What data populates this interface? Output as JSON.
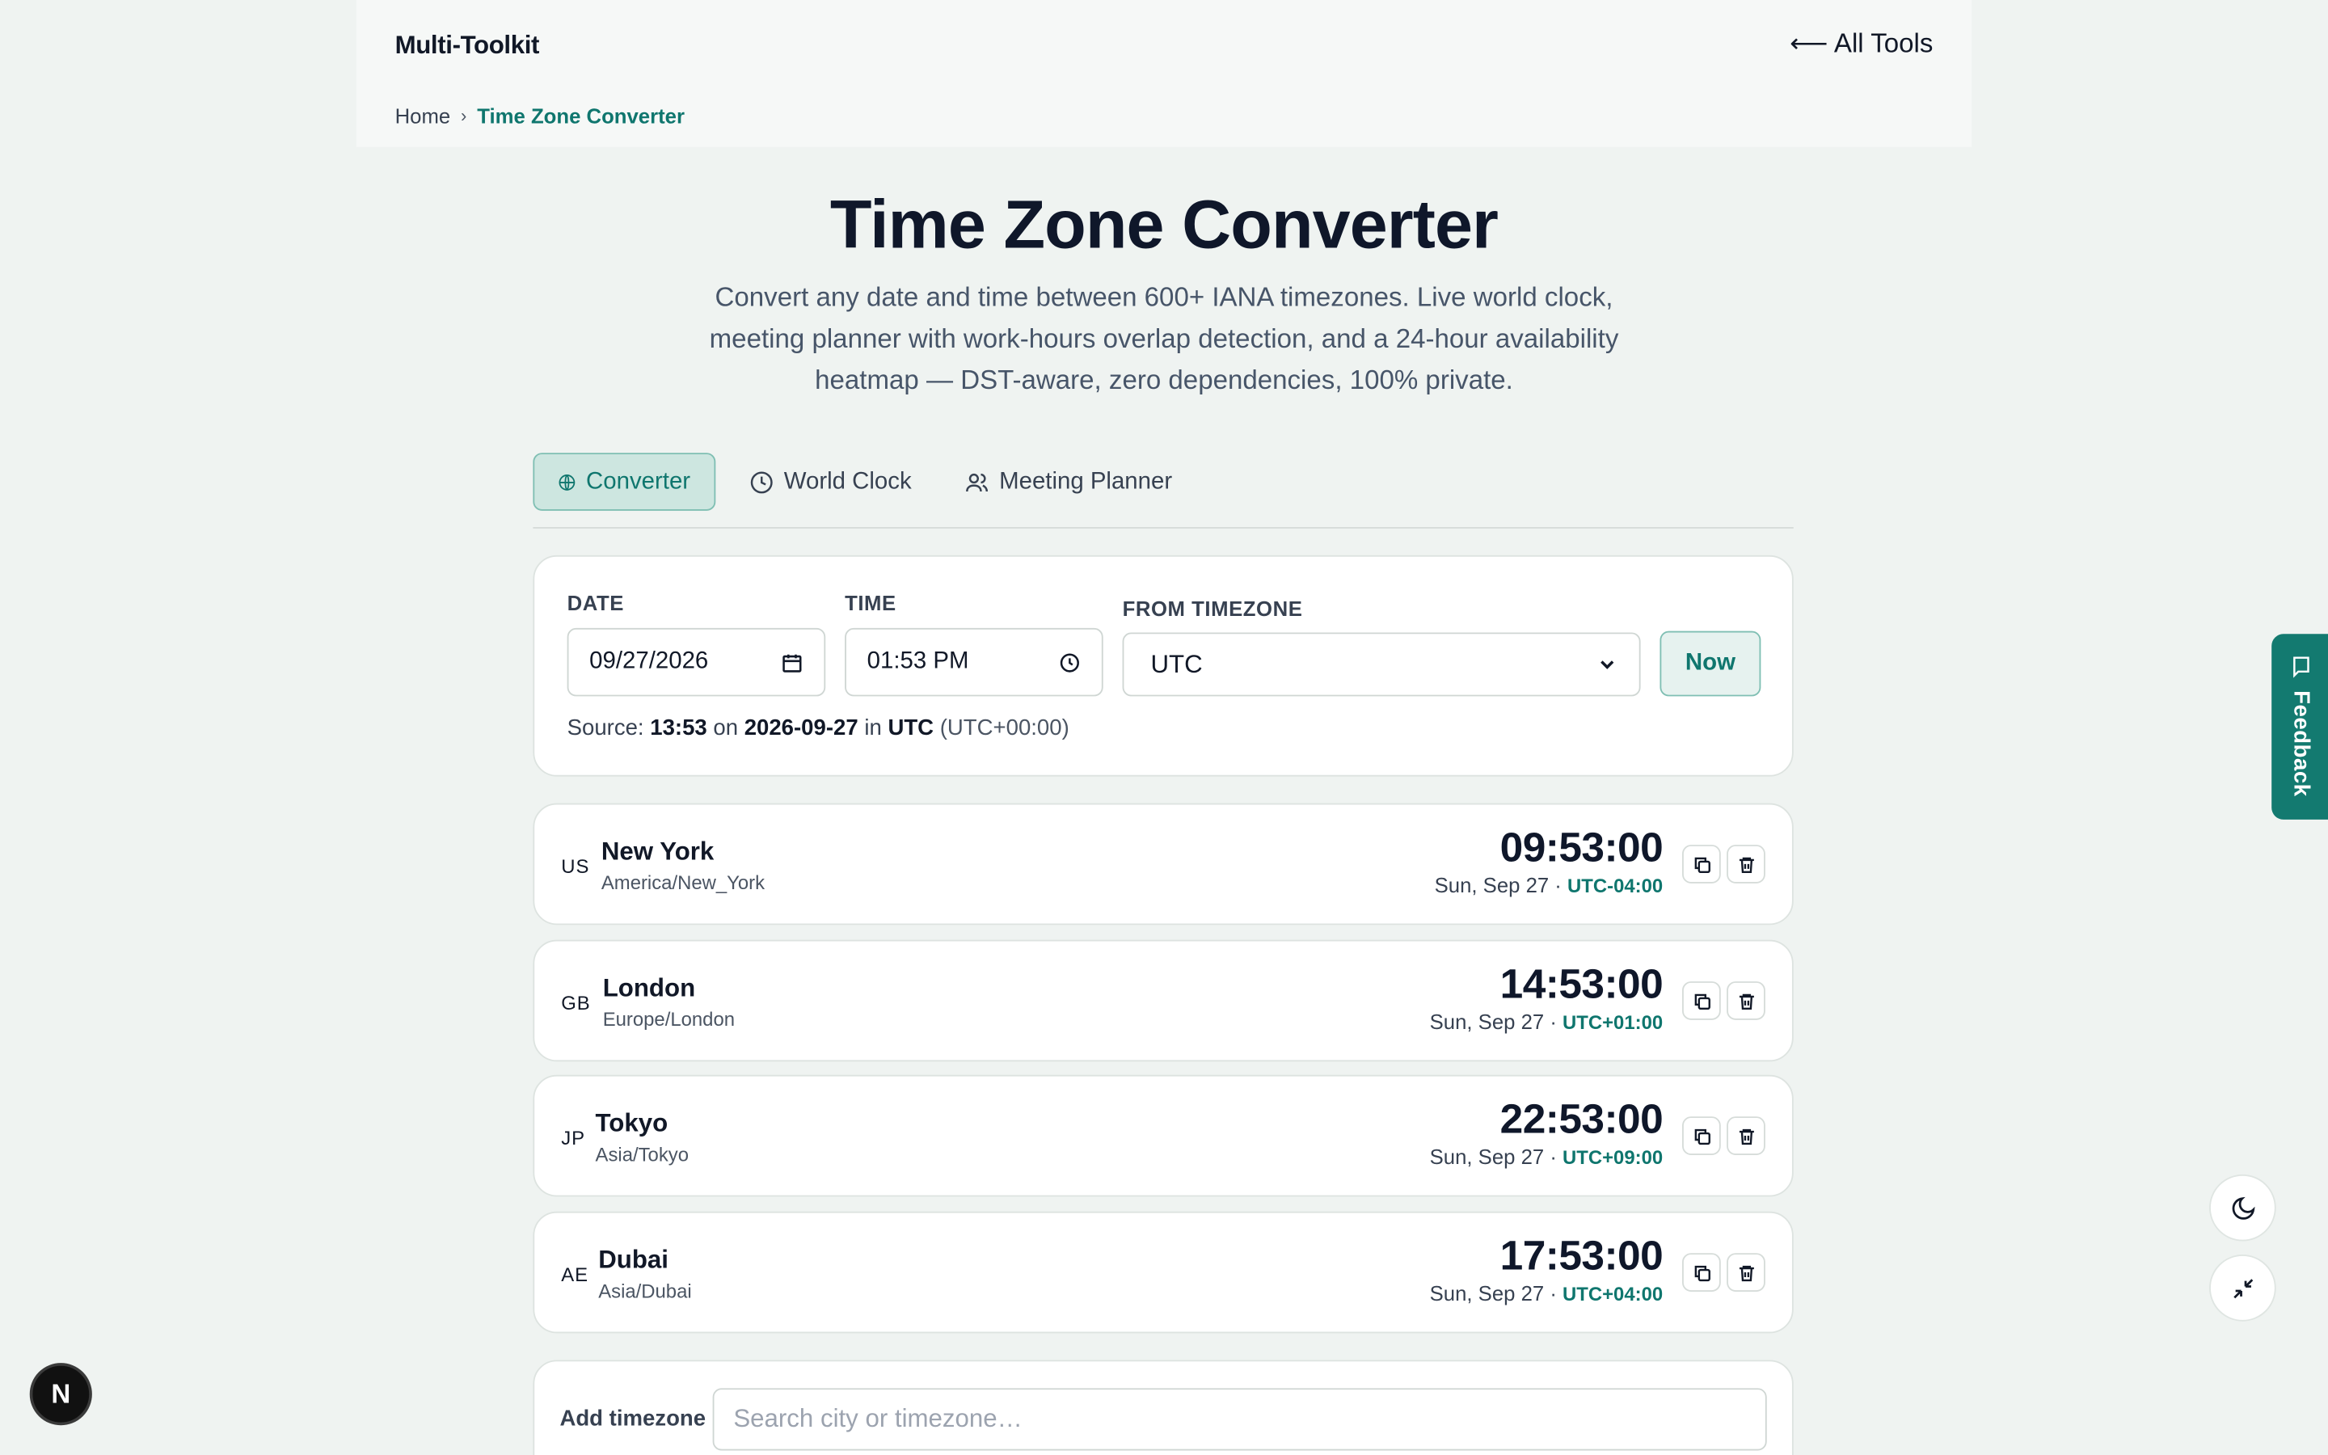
{
  "header": {
    "brand": "Multi-Toolkit",
    "all_tools": "All Tools",
    "breadcrumb": {
      "home": "Home",
      "separator": "›",
      "current": "Time Zone Converter"
    }
  },
  "hero": {
    "title": "Time Zone Converter",
    "subtitle": "Convert any date and time between 600+ IANA timezones. Live world clock, meeting planner with work-hours overlap detection, and a 24-hour availability heatmap — DST-aware, zero dependencies, 100% private."
  },
  "tabs": [
    {
      "label": "Converter",
      "icon": "globe-icon",
      "active": true
    },
    {
      "label": "World Clock",
      "icon": "clock-icon",
      "active": false
    },
    {
      "label": "Meeting Planner",
      "icon": "users-icon",
      "active": false
    }
  ],
  "form": {
    "date_label": "DATE",
    "date_value": "09/27/2026",
    "time_label": "TIME",
    "time_value": "01:53 PM",
    "from_label": "FROM TIMEZONE",
    "from_value": "UTC",
    "now_label": "Now",
    "source": {
      "prefix": "Source:",
      "time": "13:53",
      "on": "on",
      "date": "2026-09-27",
      "in": "in",
      "zone": "UTC",
      "offset": "(UTC+00:00)"
    }
  },
  "zones": [
    {
      "code": "US",
      "city": "New York",
      "iana": "America/New_York",
      "time": "09:53:00",
      "date": "Sun, Sep 27 ·",
      "offset": "UTC-04:00"
    },
    {
      "code": "GB",
      "city": "London",
      "iana": "Europe/London",
      "time": "14:53:00",
      "date": "Sun, Sep 27 ·",
      "offset": "UTC+01:00"
    },
    {
      "code": "JP",
      "city": "Tokyo",
      "iana": "Asia/Tokyo",
      "time": "22:53:00",
      "date": "Sun, Sep 27 ·",
      "offset": "UTC+09:00"
    },
    {
      "code": "AE",
      "city": "Dubai",
      "iana": "Asia/Dubai",
      "time": "17:53:00",
      "date": "Sun, Sep 27 ·",
      "offset": "UTC+04:00"
    }
  ],
  "add": {
    "label": "Add timezone",
    "placeholder": "Search city or timezone…"
  },
  "feedback": {
    "label": "Feedback"
  },
  "next_badge": "N",
  "colors": {
    "accent": "#0f766e",
    "feedback_bg": "#137a70",
    "page_bg": "#eff3f1"
  }
}
